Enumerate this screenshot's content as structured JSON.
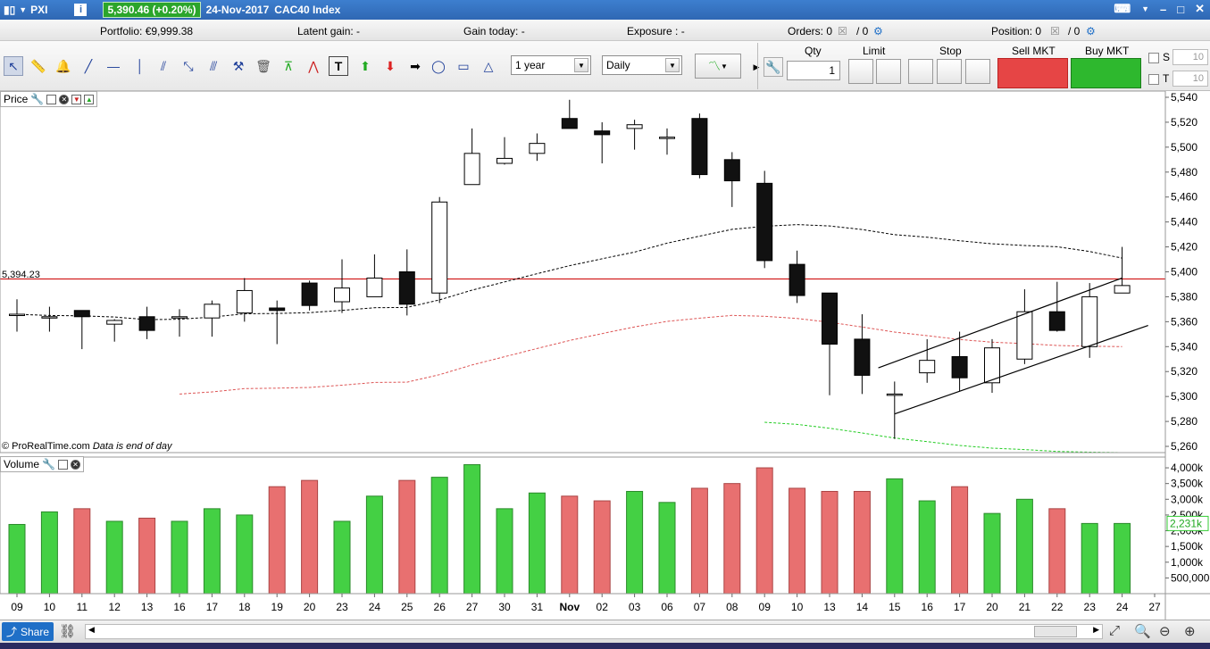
{
  "titlebar": {
    "ticker": "PXI",
    "price_badge": "5,390.46 (+0.20%)",
    "date": "24-Nov-2017",
    "instrument": "CAC40 Index"
  },
  "account": {
    "portfolio": "Portfolio: €9,999.38",
    "latent_gain": "Latent gain: -",
    "gain_today": "Gain today: -",
    "exposure": "Exposure : -",
    "orders_label": "Orders: 0",
    "orders_count": "/ 0",
    "position_label": "Position: 0",
    "position_count": "/ 0"
  },
  "toolbar": {
    "period": "1 year",
    "interval": "Daily"
  },
  "order_panel": {
    "qty_label": "Qty",
    "qty_value": "1",
    "limit_label": "Limit",
    "stop_label": "Stop",
    "sell_label": "Sell MKT",
    "buy_label": "Buy MKT",
    "s_label": "S",
    "t_label": "T",
    "s_value": "10",
    "t_value": "10"
  },
  "price_panel": {
    "label": "Price",
    "ref_price": "5,394.23",
    "ref_value": 5394.23,
    "watermark": "© ProRealTime.com",
    "watermark_note": "Data is end of day",
    "y_ticks": [
      5540,
      5520,
      5500,
      5480,
      5460,
      5440,
      5420,
      5400,
      5380,
      5360,
      5340,
      5320,
      5300,
      5280,
      5260
    ],
    "y_tick_labels": [
      "5,540",
      "5,520",
      "5,500",
      "5,480",
      "5,460",
      "5,440",
      "5,420",
      "5,400",
      "5,380",
      "5,360",
      "5,340",
      "5,320",
      "5,300",
      "5,280",
      "5,260"
    ]
  },
  "volume_panel": {
    "label": "Volume",
    "y_ticks": [
      4000000,
      3500000,
      3000000,
      2500000,
      2000000,
      1500000,
      1000000,
      500000
    ],
    "y_tick_labels": [
      "4,000k",
      "3,500k",
      "3,000k",
      "2,500k",
      "2,000k",
      "1,500k",
      "1,000k",
      "500,000"
    ],
    "current_label": "2,231k",
    "current_value": 2231000
  },
  "x_labels": [
    "09",
    "10",
    "11",
    "12",
    "13",
    "16",
    "17",
    "18",
    "19",
    "20",
    "23",
    "24",
    "25",
    "26",
    "27",
    "30",
    "31",
    "Nov",
    "02",
    "03",
    "06",
    "07",
    "08",
    "09",
    "10",
    "13",
    "14",
    "15",
    "16",
    "17",
    "20",
    "21",
    "22",
    "23",
    "24",
    "27"
  ],
  "chart_data": {
    "type": "candlestick",
    "categories": [
      "09",
      "10",
      "11",
      "12",
      "13",
      "16",
      "17",
      "18",
      "19",
      "20",
      "23",
      "24",
      "25",
      "26",
      "27",
      "30",
      "31",
      "Nov",
      "02",
      "03",
      "06",
      "07",
      "08",
      "09",
      "10",
      "13",
      "14",
      "15",
      "16",
      "17",
      "20",
      "21",
      "22",
      "23",
      "24"
    ],
    "ohlc": [
      {
        "o": 5366,
        "h": 5378,
        "l": 5352,
        "c": 5366
      },
      {
        "o": 5364,
        "h": 5372,
        "l": 5352,
        "c": 5364
      },
      {
        "o": 5369,
        "h": 5369,
        "l": 5338,
        "c": 5364
      },
      {
        "o": 5358,
        "h": 5362,
        "l": 5344,
        "c": 5361
      },
      {
        "o": 5364,
        "h": 5372,
        "l": 5346,
        "c": 5353
      },
      {
        "o": 5364,
        "h": 5370,
        "l": 5348,
        "c": 5364
      },
      {
        "o": 5363,
        "h": 5377,
        "l": 5348,
        "c": 5374
      },
      {
        "o": 5367,
        "h": 5395,
        "l": 5360,
        "c": 5385
      },
      {
        "o": 5371,
        "h": 5377,
        "l": 5342,
        "c": 5369
      },
      {
        "o": 5391,
        "h": 5393,
        "l": 5369,
        "c": 5373
      },
      {
        "o": 5376,
        "h": 5410,
        "l": 5367,
        "c": 5387
      },
      {
        "o": 5380,
        "h": 5414,
        "l": 5380,
        "c": 5395
      },
      {
        "o": 5400,
        "h": 5418,
        "l": 5365,
        "c": 5374
      },
      {
        "o": 5383,
        "h": 5460,
        "l": 5375,
        "c": 5456
      },
      {
        "o": 5470,
        "h": 5515,
        "l": 5470,
        "c": 5495
      },
      {
        "o": 5487,
        "h": 5508,
        "l": 5486,
        "c": 5491
      },
      {
        "o": 5495,
        "h": 5511,
        "l": 5489,
        "c": 5503
      },
      {
        "o": 5523,
        "h": 5538,
        "l": 5515,
        "c": 5515
      },
      {
        "o": 5513,
        "h": 5520,
        "l": 5487,
        "c": 5510
      },
      {
        "o": 5515,
        "h": 5522,
        "l": 5498,
        "c": 5518
      },
      {
        "o": 5508,
        "h": 5515,
        "l": 5494,
        "c": 5508
      },
      {
        "o": 5523,
        "h": 5527,
        "l": 5475,
        "c": 5478
      },
      {
        "o": 5490,
        "h": 5496,
        "l": 5452,
        "c": 5473
      },
      {
        "o": 5471,
        "h": 5481,
        "l": 5403,
        "c": 5409
      },
      {
        "o": 5406,
        "h": 5417,
        "l": 5375,
        "c": 5381
      },
      {
        "o": 5383,
        "h": 5383,
        "l": 5301,
        "c": 5342
      },
      {
        "o": 5346,
        "h": 5366,
        "l": 5302,
        "c": 5317
      },
      {
        "o": 5302,
        "h": 5312,
        "l": 5266,
        "c": 5302
      },
      {
        "o": 5319,
        "h": 5346,
        "l": 5311,
        "c": 5329
      },
      {
        "o": 5332,
        "h": 5352,
        "l": 5304,
        "c": 5315
      },
      {
        "o": 5311,
        "h": 5346,
        "l": 5303,
        "c": 5339
      },
      {
        "o": 5330,
        "h": 5386,
        "l": 5326,
        "c": 5368
      },
      {
        "o": 5368,
        "h": 5392,
        "l": 5352,
        "c": 5353
      },
      {
        "o": 5340,
        "h": 5391,
        "l": 5331,
        "c": 5380
      },
      {
        "o": 5383,
        "h": 5420,
        "l": 5383,
        "c": 5389
      }
    ],
    "volume": [
      2200000,
      2600000,
      2700000,
      2300000,
      2400000,
      2300000,
      2700000,
      2500000,
      3400000,
      3600000,
      2300000,
      3100000,
      3600000,
      3700000,
      4100000,
      2700000,
      3200000,
      3100000,
      2950000,
      3250000,
      2900000,
      3350000,
      3500000,
      4000000,
      3350000,
      3250000,
      3250000,
      3650000,
      2950000,
      3400000,
      2550000,
      3000000,
      2700000,
      2231000,
      2231000
    ],
    "ylim": [
      5255,
      5545
    ],
    "volume_ylim": [
      0,
      4200000
    ]
  }
}
